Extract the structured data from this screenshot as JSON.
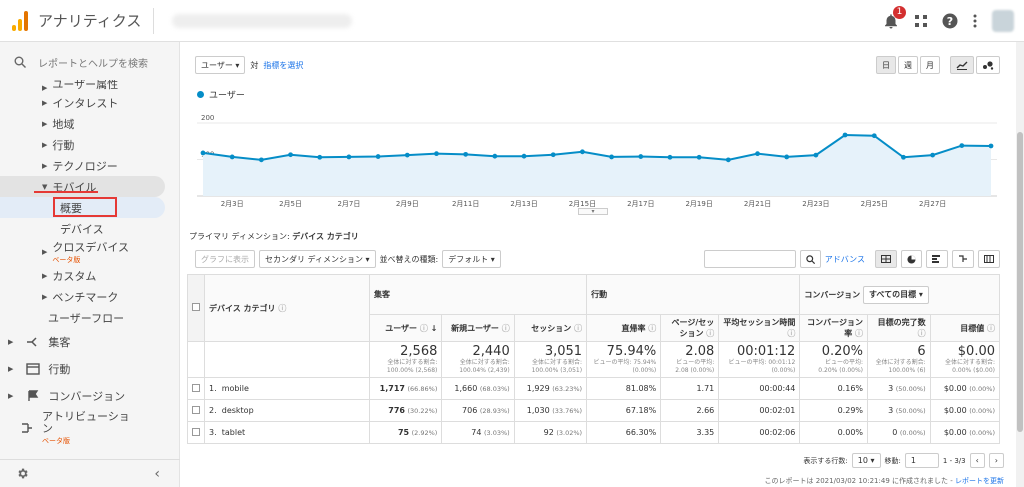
{
  "app": {
    "title": "アナリティクス",
    "account": "blurred account name"
  },
  "topbar": {
    "notification_count": "1"
  },
  "sidebar": {
    "search": "レポートとヘルプを検索",
    "audience_items": [
      {
        "label": "ユーザー属性"
      },
      {
        "label": "インタレスト"
      },
      {
        "label": "地域"
      },
      {
        "label": "行動"
      },
      {
        "label": "テクノロジー"
      },
      {
        "label": "モバイル"
      }
    ],
    "mobile_sub": [
      {
        "label": "概要"
      },
      {
        "label": "デバイス"
      }
    ],
    "cross_device": "クロスデバイス",
    "beta": "ベータ版",
    "more_items": [
      {
        "label": "カスタム"
      },
      {
        "label": "ベンチマーク"
      }
    ],
    "user_flow": "ユーザーフロー",
    "top_items": [
      {
        "label": "集客"
      },
      {
        "label": "行動"
      },
      {
        "label": "コンバージョン"
      }
    ],
    "attribution": "アトリビューション",
    "attribution_beta": "ベータ版"
  },
  "graph": {
    "metric_select": "ユーザー",
    "vs": "対",
    "pick_metric": "指標を選択",
    "ranges": [
      "日",
      "週",
      "月"
    ],
    "legend": "ユーザー"
  },
  "chart_data": {
    "type": "line",
    "series": [
      {
        "name": "ユーザー",
        "values": [
          118,
          107,
          99,
          113,
          106,
          107,
          108,
          112,
          116,
          114,
          109,
          109,
          113,
          121,
          107,
          108,
          106,
          106,
          99,
          116,
          107,
          112,
          167,
          165,
          106,
          112,
          138,
          137
        ]
      }
    ],
    "x_ticks": [
      "2月3日",
      "2月5日",
      "2月7日",
      "2月9日",
      "2月11日",
      "2月13日",
      "2月15日",
      "2月17日",
      "2月19日",
      "2月21日",
      "2月23日",
      "2月25日",
      "2月27日"
    ],
    "y_ticks": [
      "200",
      "100"
    ],
    "ylim": [
      0,
      230
    ],
    "grid": true,
    "color": "#058dc7"
  },
  "table": {
    "primary_dim_label": "プライマリ ディメンション:",
    "primary_dim_value": "デバイス カテゴリ",
    "graph_btn": "グラフに表示",
    "secondary_dim": "セカンダリ ディメンション",
    "sort_label": "並べ替えの種類:",
    "sort_value": "デフォルト",
    "advanced": "アドバンス",
    "col_device": "デバイス カテゴリ",
    "group_acq": "集客",
    "group_beh": "行動",
    "group_conv": "コンバージョン",
    "goal_select": "すべての目標",
    "cols": [
      "ユーザー",
      "新規ユーザー",
      "セッション",
      "直帰率",
      "ページ/セッション",
      "平均セッション時間",
      "コンバージョン率",
      "目標の完了数",
      "目標値"
    ],
    "totals": [
      {
        "v": "2,568",
        "s": "全体に対する割合: 100.00% (2,568)"
      },
      {
        "v": "2,440",
        "s": "全体に対する割合: 100.04% (2,439)"
      },
      {
        "v": "3,051",
        "s": "全体に対する割合: 100.00% (3,051)"
      },
      {
        "v": "75.94%",
        "s": "ビューの平均: 75.94% (0.00%)"
      },
      {
        "v": "2.08",
        "s": "ビューの平均: 2.08 (0.00%)"
      },
      {
        "v": "00:01:12",
        "s": "ビューの平均: 00:01:12 (0.00%)"
      },
      {
        "v": "0.20%",
        "s": "ビューの平均: 0.20% (0.00%)"
      },
      {
        "v": "6",
        "s": "全体に対する割合: 100.00% (6)"
      },
      {
        "v": "$0.00",
        "s": "全体に対する割合: 0.00% ($0.00)"
      }
    ],
    "rows": [
      {
        "n": "1.",
        "name": "mobile",
        "users": "1,717",
        "users_pct": "(66.86%)",
        "new": "1,660",
        "new_pct": "(68.03%)",
        "sess": "1,929",
        "sess_pct": "(63.23%)",
        "bounce": "81.08%",
        "pps": "1.71",
        "dur": "00:00:44",
        "cr": "0.16%",
        "goal": "3",
        "goal_pct": "(50.00%)",
        "val": "$0.00",
        "val_pct": "(0.00%)"
      },
      {
        "n": "2.",
        "name": "desktop",
        "users": "776",
        "users_pct": "(30.22%)",
        "new": "706",
        "new_pct": "(28.93%)",
        "sess": "1,030",
        "sess_pct": "(33.76%)",
        "bounce": "67.18%",
        "pps": "2.66",
        "dur": "00:02:01",
        "cr": "0.29%",
        "goal": "3",
        "goal_pct": "(50.00%)",
        "val": "$0.00",
        "val_pct": "(0.00%)"
      },
      {
        "n": "3.",
        "name": "tablet",
        "users": "75",
        "users_pct": "(2.92%)",
        "new": "74",
        "new_pct": "(3.03%)",
        "sess": "92",
        "sess_pct": "(3.02%)",
        "bounce": "66.30%",
        "pps": "3.35",
        "dur": "00:02:06",
        "cr": "0.00%",
        "goal": "0",
        "goal_pct": "(0.00%)",
        "val": "$0.00",
        "val_pct": "(0.00%)"
      }
    ],
    "rows_label": "表示する行数:",
    "rows_value": "10",
    "goto_label": "移動:",
    "goto_value": "1",
    "range": "1 - 3/3",
    "footnote": "このレポートは 2021/03/02 10:21:49 に作成されました -",
    "refresh": "レポートを更新"
  },
  "colors": {
    "accent": "#058dc7",
    "highlight_box": "#e53935"
  }
}
